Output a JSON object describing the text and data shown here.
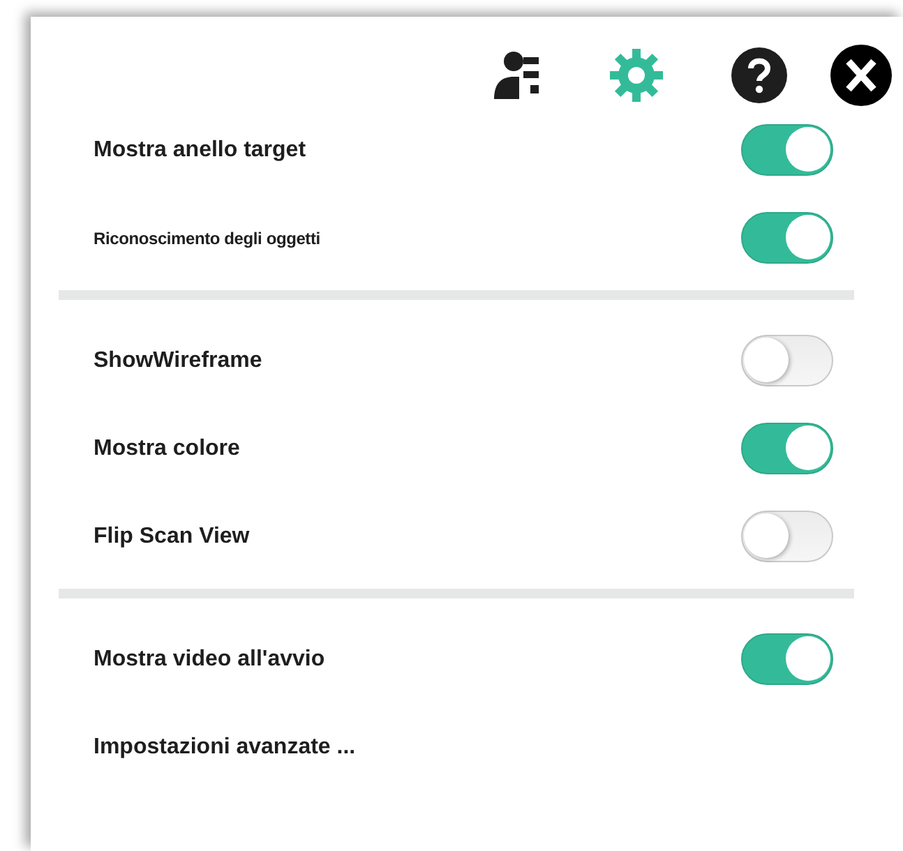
{
  "toolbar": [
    {
      "kind": "profile",
      "selected": false
    },
    {
      "kind": "settings",
      "selected": true
    },
    {
      "kind": "help",
      "selected": false
    },
    {
      "kind": "close",
      "selected": false
    }
  ],
  "sections": [
    {
      "items": [
        {
          "kind": "toggle",
          "label": "Mostra anello target",
          "small": false,
          "on": true
        },
        {
          "kind": "toggle",
          "label": "Riconoscimento degli oggetti",
          "small": true,
          "on": true
        }
      ]
    },
    {
      "items": [
        {
          "kind": "toggle",
          "label": "ShowWireframe",
          "small": false,
          "on": false
        },
        {
          "kind": "toggle",
          "label": "Mostra colore",
          "small": false,
          "on": true
        },
        {
          "kind": "toggle",
          "label": "Flip Scan View",
          "small": false,
          "on": false
        }
      ]
    },
    {
      "items": [
        {
          "kind": "toggle",
          "label": "Mostra video all'avvio",
          "small": false,
          "on": true
        },
        {
          "kind": "link",
          "label": "Impostazioni avanzate ..."
        }
      ]
    }
  ]
}
